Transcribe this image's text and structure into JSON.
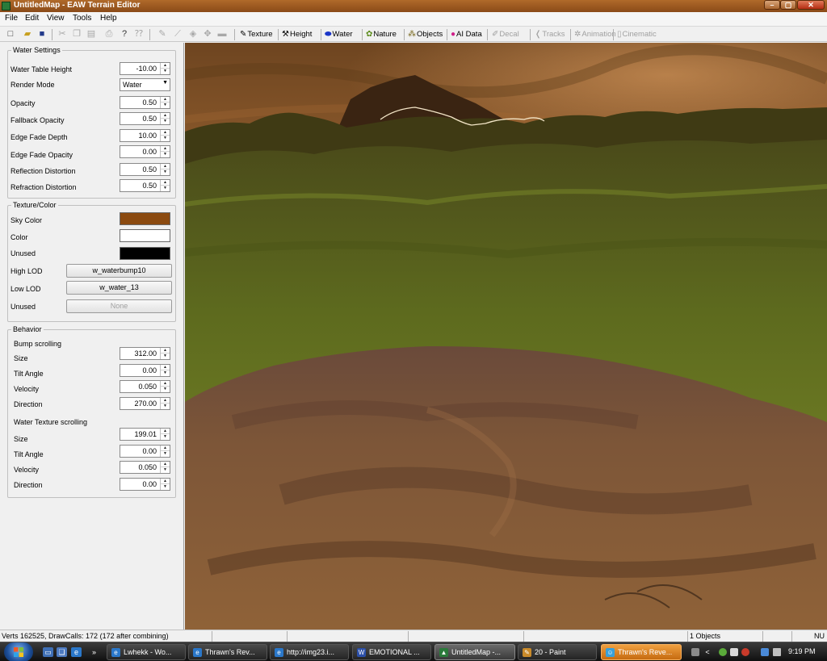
{
  "window": {
    "title": "UntitledMap - EAW Terrain Editor",
    "controls": {
      "minimize": "–",
      "maximize": "▢",
      "close": "✕"
    }
  },
  "menu": [
    "File",
    "Edit",
    "View",
    "Tools",
    "Help"
  ],
  "toolbar": {
    "tools": [
      {
        "label": "Texture",
        "icon": "brush-icon",
        "enabled": true
      },
      {
        "label": "Height",
        "icon": "hammer-icon",
        "enabled": true
      },
      {
        "label": "Water",
        "icon": "water-drop-icon",
        "enabled": true
      },
      {
        "label": "Nature",
        "icon": "plant-icon",
        "enabled": true
      },
      {
        "label": "Objects",
        "icon": "objects-icon",
        "enabled": true
      },
      {
        "label": "AI Data",
        "icon": "pin-icon",
        "enabled": true
      },
      {
        "label": "Decal",
        "icon": "decal-icon",
        "enabled": false
      },
      {
        "label": "Tracks",
        "icon": "tracks-icon",
        "enabled": false
      },
      {
        "label": "Animation",
        "icon": "animation-icon",
        "enabled": false
      },
      {
        "label": "Cinematic",
        "icon": "cinematic-icon",
        "enabled": false
      }
    ]
  },
  "water_settings": {
    "title": "Water Settings",
    "water_table_height": {
      "label": "Water Table Height",
      "value": "-10.00"
    },
    "render_mode": {
      "label": "Render Mode",
      "value": "Water"
    },
    "opacity": {
      "label": "Opacity",
      "value": "0.50"
    },
    "fallback_opacity": {
      "label": "Fallback Opacity",
      "value": "0.50"
    },
    "edge_fade_depth": {
      "label": "Edge Fade Depth",
      "value": "10.00"
    },
    "edge_fade_opacity": {
      "label": "Edge Fade Opacity",
      "value": "0.00"
    },
    "reflection_distortion": {
      "label": "Reflection Distortion",
      "value": "0.50"
    },
    "refraction_distortion": {
      "label": "Refraction Distortion",
      "value": "0.50"
    }
  },
  "texture_color": {
    "title": "Texture/Color",
    "sky_color": {
      "label": "Sky Color",
      "color": "#8b4a10"
    },
    "color": {
      "label": "Color",
      "color": "#ffffff"
    },
    "unused_color": {
      "label": "Unused",
      "color": "#000000"
    },
    "high_lod": {
      "label": "High LOD",
      "value": "w_waterbump10"
    },
    "low_lod": {
      "label": "Low LOD",
      "value": "w_water_13"
    },
    "unused_tex": {
      "label": "Unused",
      "value": "None"
    }
  },
  "behavior": {
    "title": "Behavior",
    "bump_scrolling": {
      "heading": "Bump scrolling",
      "size": {
        "label": "Size",
        "value": "312.00"
      },
      "tilt_angle": {
        "label": "Tilt Angle",
        "value": "0.00"
      },
      "velocity": {
        "label": "Velocity",
        "value": "0.050"
      },
      "direction": {
        "label": "Direction",
        "value": "270.00"
      }
    },
    "texture_scrolling": {
      "heading": "Water Texture scrolling",
      "size": {
        "label": "Size",
        "value": "199.01"
      },
      "tilt_angle": {
        "label": "Tilt Angle",
        "value": "0.00"
      },
      "velocity": {
        "label": "Velocity",
        "value": "0.050"
      },
      "direction": {
        "label": "Direction",
        "value": "0.00"
      }
    }
  },
  "status": {
    "stats": "Verts 162525, DrawCalls: 172 (172 after combining)",
    "objects": "1 Objects",
    "mode": "NU"
  },
  "taskbar": {
    "items": [
      {
        "label": "Lwhekk - Wo...",
        "icon": "ie-icon"
      },
      {
        "label": "Thrawn's Rev...",
        "icon": "ie-icon"
      },
      {
        "label": "http://img23.i...",
        "icon": "ie-icon"
      },
      {
        "label": "EMOTIONAL ...",
        "icon": "word-icon"
      },
      {
        "label": "UntitledMap -...",
        "icon": "terrain-editor-icon"
      },
      {
        "label": "20 - Paint",
        "icon": "paint-icon"
      },
      {
        "label": "Thrawn's Reve...",
        "icon": "messenger-icon"
      }
    ],
    "quicklaunch_more": "»",
    "tray_arrow": "<",
    "clock": "9:19 PM"
  }
}
